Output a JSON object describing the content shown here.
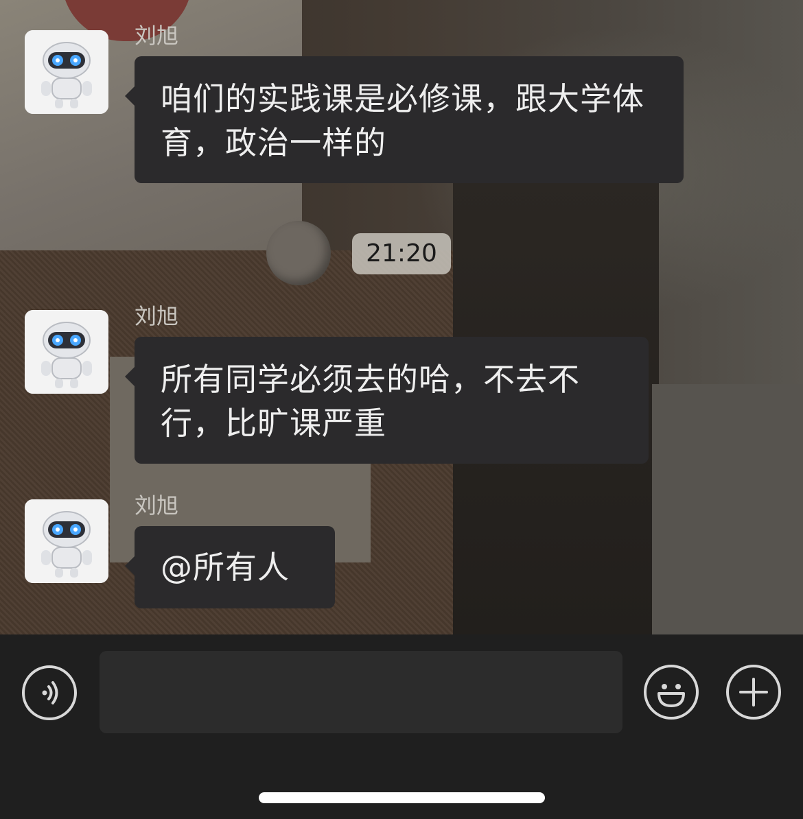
{
  "messages": [
    {
      "sender": "刘旭",
      "text": "咱们的实践课是必修课，跟大学体育，政治一样的"
    },
    {
      "sender": "刘旭",
      "text": "所有同学必须去的哈，不去不行，比旷课严重"
    },
    {
      "sender": "刘旭",
      "text": "@所有人"
    }
  ],
  "timestamp": "21:20",
  "input": {
    "value": "",
    "placeholder": ""
  },
  "icons": {
    "avatar": "robot-avatar-icon",
    "voice": "voice-icon",
    "emoji": "emoji-icon",
    "plus": "plus-icon"
  },
  "colors": {
    "bubble": "#2b2a2c",
    "bubble_text": "#eeeeee",
    "input_bar": "#1f1f1f",
    "time_pill": "#c8c4bc"
  }
}
